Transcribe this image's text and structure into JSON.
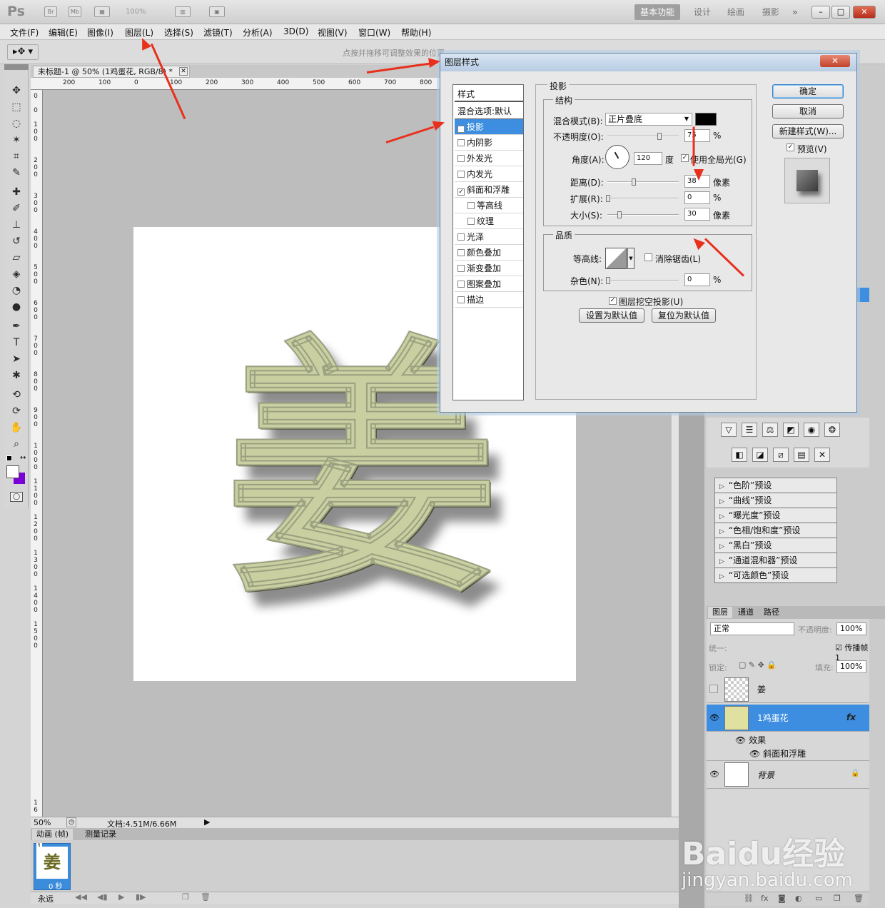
{
  "app": {
    "logo": "Ps",
    "bridge_label": "Br",
    "mini_bridge_label": "Mb",
    "zoom_dropdown": "100%"
  },
  "workspaces": {
    "basic": "基本功能",
    "design": "设计",
    "paint": "绘画",
    "photo": "摄影",
    "more": "»"
  },
  "window_controls": {
    "minimize": "–",
    "restore": "□",
    "close": "✕"
  },
  "menus": [
    "文件(F)",
    "编辑(E)",
    "图像(I)",
    "图层(L)",
    "选择(S)",
    "滤镜(T)",
    "分析(A)",
    "3D(D)",
    "视图(V)",
    "窗口(W)",
    "帮助(H)"
  ],
  "options_bar": {
    "hint": "点按并拖移可调整效果的位置"
  },
  "document": {
    "tab_title": "未标题-1 @ 50% (1鸡蛋花, RGB/8) *",
    "tab_close": "✕",
    "ruler_h": [
      "200",
      "100",
      "0",
      "100",
      "200",
      "300",
      "400",
      "500",
      "600",
      "700",
      "800"
    ],
    "ruler_v": [
      "0",
      "0",
      "1 0 0",
      "2 0 0",
      "3 0 0",
      "4 0 0",
      "5 0 0",
      "6 0 0",
      "7 0 0",
      "8 0 0",
      "9 0 0",
      "1 0 0 0",
      "1 1 0 0",
      "1 2 0 0",
      "1 3 0 0",
      "1 4 0 0",
      "1 5 0 0",
      "1 6"
    ],
    "canvas_character": "姜"
  },
  "status": {
    "zoom": "50%",
    "doc_info": "文档:4.51M/6.66M"
  },
  "animation_panel": {
    "tab_animation": "动画 (帧)",
    "tab_measure": "测量记录",
    "frame_number": "1",
    "frame_delay": "0 秒",
    "frame_glyph": "姜",
    "loop": "永远"
  },
  "adjustments": {
    "presets": [
      "“色阶”预设",
      "“曲线”预设",
      "“曝光度”预设",
      "“色相/饱和度”预设",
      "“黑白”预设",
      "“通道混和器”预设",
      "“可选颜色”预设"
    ]
  },
  "layers_panel": {
    "tabs": [
      "图层",
      "通道",
      "路径"
    ],
    "blend_mode": "正常",
    "opacity_label": "不透明度:",
    "opacity_value": "100%",
    "unify_label": "统一:",
    "propagate_label": "传播帧 1",
    "lock_label": "锁定:",
    "fill_label": "填充:",
    "fill_value": "100%",
    "layers": [
      {
        "name": "姜",
        "visible": false
      },
      {
        "name": "1鸡蛋花",
        "visible": true,
        "selected": true,
        "fx": "fx"
      },
      {
        "name": "效果"
      },
      {
        "name": "斜面和浮雕"
      },
      {
        "name": "背景",
        "visible": true,
        "locked": true
      }
    ]
  },
  "dialog": {
    "title": "图层样式",
    "close": "✕",
    "styles_header": "样式",
    "blend_options": "混合选项:默认",
    "styles": [
      {
        "label": "投影",
        "checked": true,
        "active": true
      },
      {
        "label": "内阴影",
        "checked": false
      },
      {
        "label": "外发光",
        "checked": false
      },
      {
        "label": "内发光",
        "checked": false
      },
      {
        "label": "斜面和浮雕",
        "checked": true
      },
      {
        "label": "等高线",
        "checked": false,
        "indent": true
      },
      {
        "label": "纹理",
        "checked": false,
        "indent": true
      },
      {
        "label": "光泽",
        "checked": false
      },
      {
        "label": "颜色叠加",
        "checked": false
      },
      {
        "label": "渐变叠加",
        "checked": false
      },
      {
        "label": "图案叠加",
        "checked": false
      },
      {
        "label": "描边",
        "checked": false
      }
    ],
    "section_title": "投影",
    "structure_title": "结构",
    "blend_mode_label": "混合模式(B):",
    "blend_mode_value": "正片叠底",
    "shadow_color": "#000000",
    "opacity_label": "不透明度(O):",
    "opacity_value": "75",
    "percent": "%",
    "angle_label": "角度(A):",
    "angle_value": "120",
    "degree": "度",
    "global_light": "使用全局光(G)",
    "distance_label": "距离(D):",
    "distance_value": "38",
    "pixels": "像素",
    "spread_label": "扩展(R):",
    "spread_value": "0",
    "size_label": "大小(S):",
    "size_value": "30",
    "quality_title": "品质",
    "contour_label": "等高线:",
    "antialias_label": "消除锯齿(L)",
    "noise_label": "杂色(N):",
    "noise_value": "0",
    "knockout_label": "图层挖空投影(U)",
    "set_default": "设置为默认值",
    "reset_default": "复位为默认值",
    "ok": "确定",
    "cancel": "取消",
    "new_style": "新建样式(W)...",
    "preview": "预览(V)"
  },
  "watermark": {
    "brand": "Baidu经验",
    "url": "jingyan.baidu.com"
  }
}
